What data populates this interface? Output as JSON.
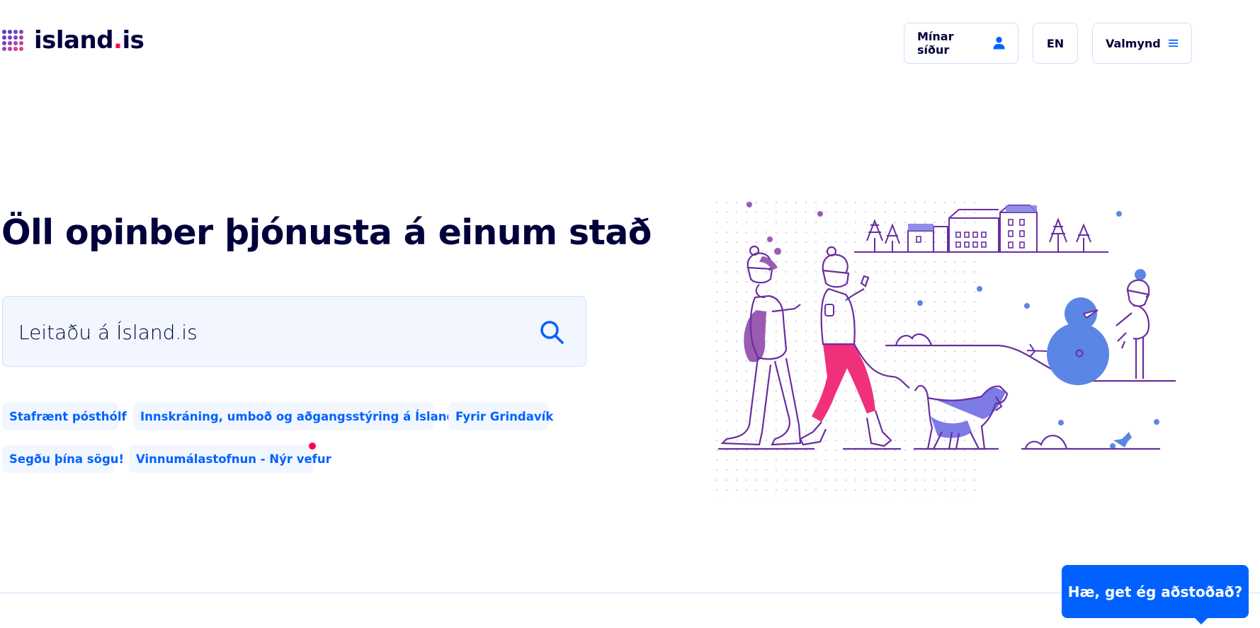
{
  "header": {
    "logo_text_main": "island",
    "logo_text_dot": ".",
    "logo_text_suffix": "is",
    "my_pages_label": "Mínar síður",
    "language_label": "EN",
    "menu_label": "Valmynd"
  },
  "hero": {
    "title": "Öll opinber þjónusta á einum stað",
    "search_placeholder": "Leitaðu á Ísland.is"
  },
  "tags": [
    {
      "label": "Stafrænt pósthólf"
    },
    {
      "label": "Innskráning, umboð og aðgangsstýring á Ísland.is"
    },
    {
      "label": "Fyrir Grindavík"
    },
    {
      "label": "Segðu þína sögu!"
    },
    {
      "label": "Vinnumálastofnun - Nýr vefur",
      "has_notification": true
    }
  ],
  "chat": {
    "label": "Hæ, get ég aðstoðað?"
  },
  "colors": {
    "primary_blue": "#0061ff",
    "dark_text": "#00003c",
    "accent_red": "#ff0050",
    "light_blue_bg": "#f2f7ff",
    "border_blue": "#ccdfff",
    "illustration_purple": "#6a2ea0",
    "illustration_pink": "#f0307a",
    "illustration_blue": "#5b86e5"
  },
  "icons": {
    "user": "user-icon",
    "menu": "menu-icon",
    "search": "search-icon",
    "logo": "island-logo-dots"
  }
}
